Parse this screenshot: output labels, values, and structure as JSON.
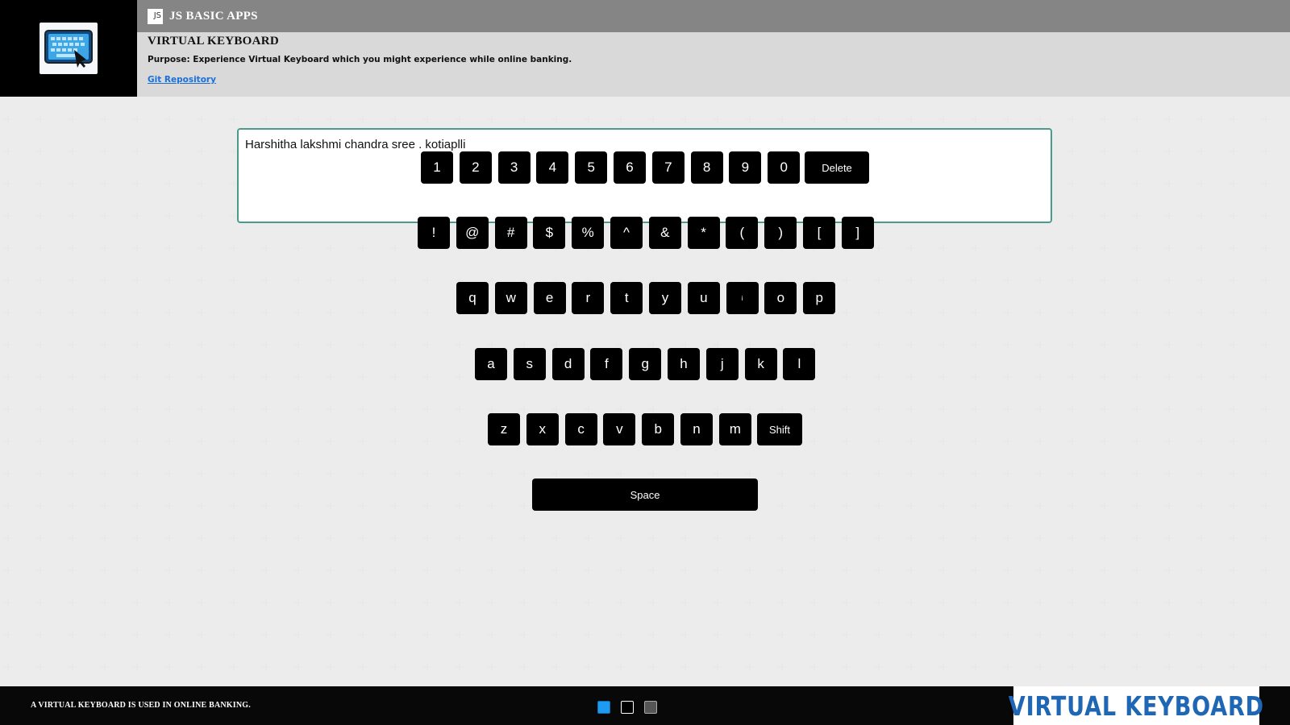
{
  "header": {
    "brand": "JS BASIC APPS",
    "js_icon": "JS",
    "app_title": "VIRTUAL KEYBOARD",
    "purpose": "Purpose: Experience Virtual Keyboard which you might experience while online banking.",
    "repo_link": "Git Repository",
    "logo_icon": "tablet-keyboard-icon"
  },
  "main": {
    "textarea_value": "Harshitha lakshmi chandra sree . kotiaplli"
  },
  "keyboard": {
    "row_numbers": [
      "1",
      "2",
      "3",
      "4",
      "5",
      "6",
      "7",
      "8",
      "9",
      "0"
    ],
    "delete_label": "Delete",
    "row_symbols": [
      "!",
      "@",
      "#",
      "$",
      "%",
      "^",
      "&",
      "*",
      "(",
      ")",
      "[",
      "]"
    ],
    "row_top": [
      "q",
      "w",
      "e",
      "r",
      "t",
      "y",
      "u",
      "i",
      "o",
      "p"
    ],
    "row_home": [
      "a",
      "s",
      "d",
      "f",
      "g",
      "h",
      "j",
      "k",
      "l"
    ],
    "row_bottom": [
      "z",
      "x",
      "c",
      "v",
      "b",
      "n",
      "m"
    ],
    "shift_label": "Shift",
    "space_label": "Space"
  },
  "footer": {
    "text": "A VIRTUAL KEYBOARD IS USED IN ONLINE BANKING.",
    "logo_text": "VIRTUAL KEYBOARD",
    "theme_swatches": [
      {
        "name": "blue",
        "color": "#1e9bf0"
      },
      {
        "name": "black",
        "color": "#000000"
      },
      {
        "name": "gray",
        "color": "#555555"
      }
    ]
  },
  "colors": {
    "key_bg": "#000000",
    "textarea_border": "#4a9a8f",
    "topbar": "#858585",
    "infobar": "#d9d9d9",
    "link": "#1a6fd8",
    "footer_logo": "#1f66b5"
  }
}
